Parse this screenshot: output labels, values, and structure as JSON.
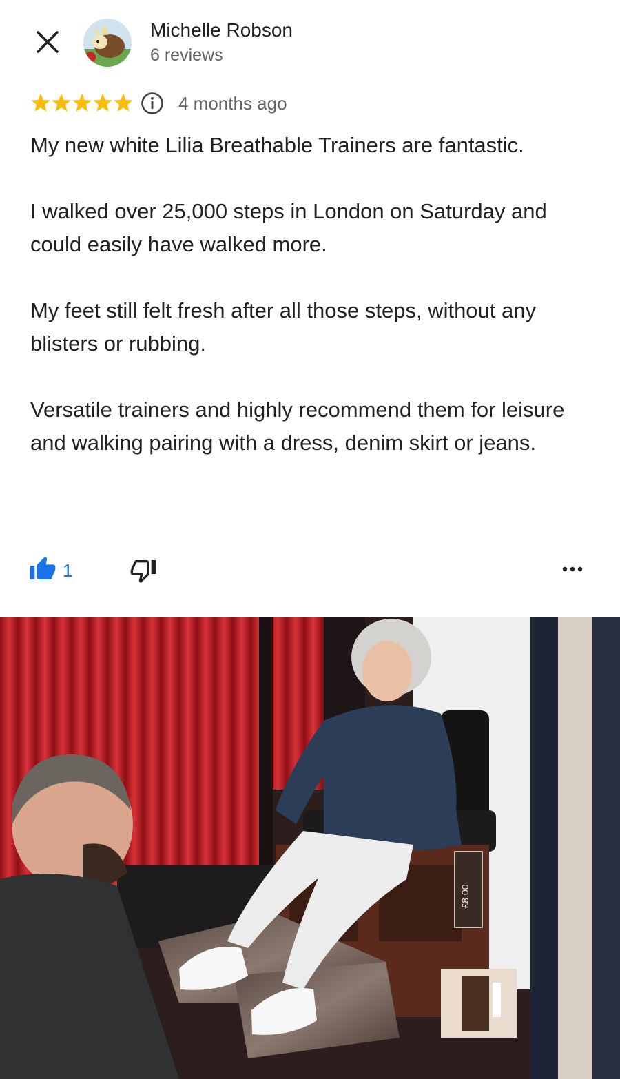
{
  "reviewer": {
    "name": "Michelle Robson",
    "reviews_label": "6 reviews"
  },
  "review": {
    "rating": 5,
    "max_rating": 5,
    "time_ago": "4 months ago",
    "paragraphs": [
      "My new white Lilia Breathable Trainers are fantastic.",
      "I walked over 25,000 steps in London on Saturday and could easily have walked more.",
      "My feet still felt fresh after all those steps, without any blisters or rubbing.",
      "Versatile trainers and highly recommend them for leisure and walking pairing with a dress, denim skirt or jeans."
    ]
  },
  "actions": {
    "like_count": "1"
  },
  "photo": {
    "sign_price": "£8.00"
  },
  "icons": {
    "close": "close-icon",
    "info": "info-icon",
    "like": "thumbs-up-icon",
    "dislike": "thumbs-down-icon",
    "more": "more-horizontal-icon",
    "star": "star-icon"
  },
  "colors": {
    "star": "#fbbc04",
    "like": "#1a73e8",
    "text": "#202124",
    "secondary": "#5f6368"
  }
}
